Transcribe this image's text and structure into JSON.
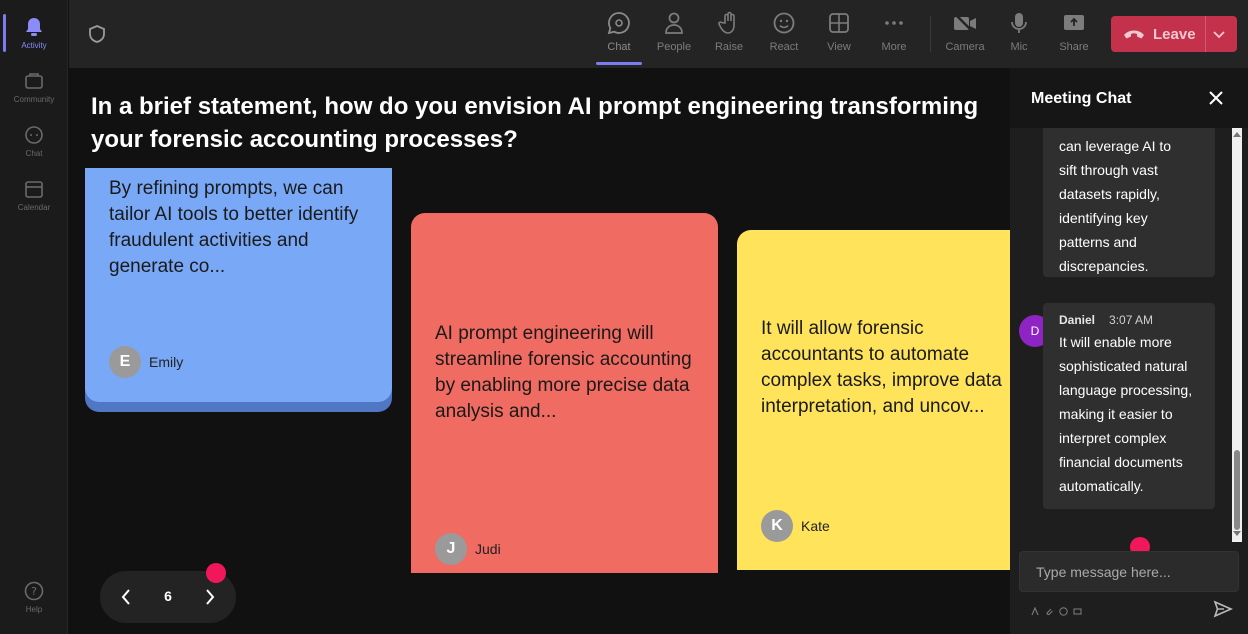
{
  "rail": {
    "items": [
      {
        "label": "Activity",
        "icon": "bell-icon"
      },
      {
        "label": "Community",
        "icon": "community-icon"
      },
      {
        "label": "Chat",
        "icon": "chat-icon"
      },
      {
        "label": "Calendar",
        "icon": "calendar-icon"
      }
    ],
    "help_label": "Help"
  },
  "toolbar": {
    "chat": "Chat",
    "people": "People",
    "raise": "Raise",
    "react": "React",
    "view": "View",
    "more": "More",
    "camera": "Camera",
    "mic": "Mic",
    "share": "Share",
    "leave": "Leave"
  },
  "main": {
    "question": "In a brief statement, how do you envision AI prompt engineering transforming your forensic accounting processes?",
    "cards": [
      {
        "text": "By refining prompts, we can tailor AI tools to better identify fraudulent activities and generate co...",
        "initial": "E",
        "author": "Emily",
        "color": "#79a8f6"
      },
      {
        "text": "AI prompt engineering will streamline forensic accounting by enabling more precise data analysis and...",
        "initial": "J",
        "author": "Judi",
        "color": "#f06b62"
      },
      {
        "text": "It will allow forensic accountants to automate complex tasks, improve data interpretation, and uncov...",
        "initial": "K",
        "author": "Kate",
        "color": "#fee35b"
      }
    ],
    "page": "6"
  },
  "chat": {
    "title": "Meeting Chat",
    "messages": [
      {
        "text_lines": [
          "can leverage AI to",
          "sift through vast",
          "datasets rapidly,",
          "identifying key",
          "patterns and",
          "discrepancies."
        ]
      },
      {
        "sender": "Daniel",
        "initial": "D",
        "time": "3:07 AM",
        "text_lines": [
          "It will enable more",
          "sophisticated natural",
          "language processing,",
          "making it easier to",
          "interpret complex",
          "financial documents",
          "automatically."
        ]
      }
    ],
    "input_placeholder": "Type message here..."
  },
  "colors": {
    "accent": "#7b7cf0",
    "leave": "#c4314b",
    "marker": "#f0185a"
  }
}
